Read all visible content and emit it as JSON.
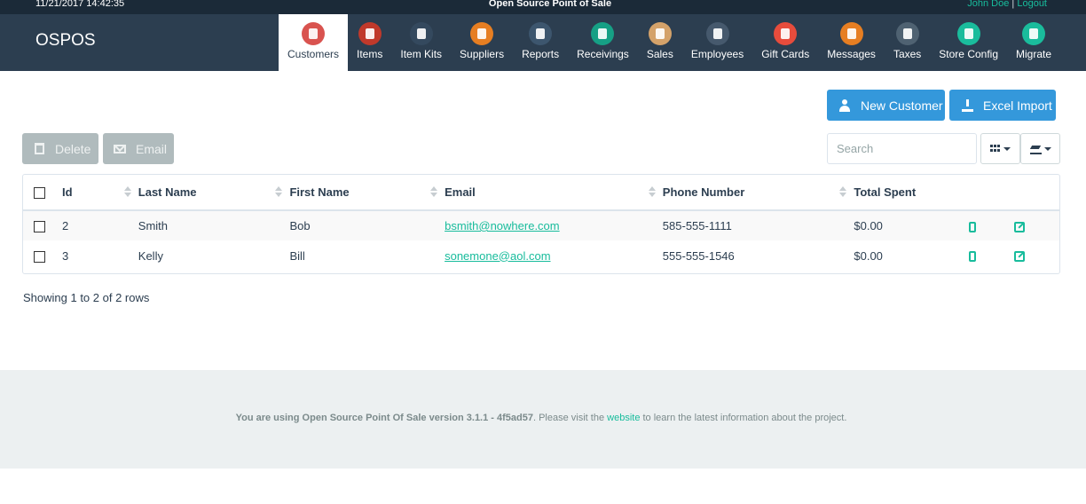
{
  "topbar": {
    "datetime": "11/21/2017 14:42:35",
    "title": "Open Source Point of Sale",
    "user": "John Doe",
    "separator": "|",
    "logout": "Logout"
  },
  "navbar": {
    "brand": "OSPOS",
    "items": [
      {
        "label": "Customers",
        "icon": "customers-icon",
        "color": "#d9534f",
        "active": true
      },
      {
        "label": "Items",
        "icon": "items-icon",
        "color": "#c0392b"
      },
      {
        "label": "Item Kits",
        "icon": "item-kits-icon",
        "color": "#34495e"
      },
      {
        "label": "Suppliers",
        "icon": "suppliers-icon",
        "color": "#e67e22"
      },
      {
        "label": "Reports",
        "icon": "reports-icon",
        "color": "#3d566e"
      },
      {
        "label": "Receivings",
        "icon": "receivings-icon",
        "color": "#16a085"
      },
      {
        "label": "Sales",
        "icon": "sales-icon",
        "color": "#d4a26a"
      },
      {
        "label": "Employees",
        "icon": "employees-icon",
        "color": "#46596d"
      },
      {
        "label": "Gift Cards",
        "icon": "gift-cards-icon",
        "color": "#e74c3c"
      },
      {
        "label": "Messages",
        "icon": "messages-icon",
        "color": "#e67e22"
      },
      {
        "label": "Taxes",
        "icon": "taxes-icon",
        "color": "#4f6272"
      },
      {
        "label": "Store Config",
        "icon": "store-config-icon",
        "color": "#1abc9c"
      },
      {
        "label": "Migrate",
        "icon": "migrate-icon",
        "color": "#1abc9c"
      }
    ]
  },
  "actions": {
    "new_customer": "New Customer",
    "excel_import": "Excel Import",
    "delete": "Delete",
    "email": "Email"
  },
  "search": {
    "placeholder": "Search"
  },
  "table": {
    "columns": [
      "Id",
      "Last Name",
      "First Name",
      "Email",
      "Phone Number",
      "Total Spent"
    ],
    "rows": [
      {
        "id": "2",
        "last_name": "Smith",
        "first_name": "Bob",
        "email": "bsmith@nowhere.com",
        "phone": "585-555-1111",
        "total": "$0.00"
      },
      {
        "id": "3",
        "last_name": "Kelly",
        "first_name": "Bill",
        "email": "sonemone@aol.com",
        "phone": "555-555-1546",
        "total": "$0.00"
      }
    ]
  },
  "pagination": {
    "summary": "Showing 1 to 2 of 2 rows"
  },
  "footer": {
    "prefix": "You are using Open Source Point Of Sale version 3.1.1 - 4f5ad57",
    "middle": ". Please visit the ",
    "link": "website",
    "suffix": " to learn the latest information about the project."
  },
  "colors": {
    "accent": "#18bc9c",
    "primary": "#3498db",
    "navbar": "#2c3e50"
  }
}
